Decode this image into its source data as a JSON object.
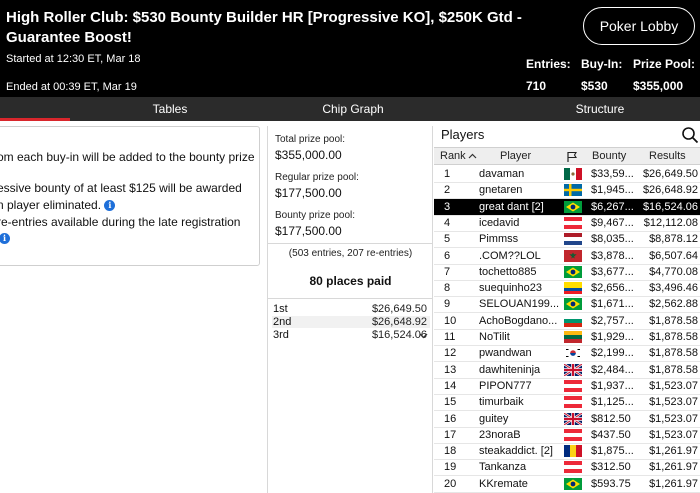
{
  "header": {
    "title": "High Roller Club: $530 Bounty Builder HR [Progressive KO], $250K Gtd - Guarantee Boost!",
    "started": "Started at 12:30 ET, Mar 18",
    "ended": "Ended at 00:39 ET, Mar 19",
    "lobby_button": "Poker Lobby",
    "stats": [
      {
        "label": "Entries:",
        "value": "710"
      },
      {
        "label": "Buy-In:",
        "value": "$530"
      },
      {
        "label": "Prize Pool:",
        "value": "$355,000"
      }
    ]
  },
  "tabs": [
    "Tables",
    "Chip Graph",
    "Structure"
  ],
  "info": {
    "line1": "om each buy-in will be added to the bounty prize",
    "line2": "essive bounty of at least $125 will be awarded",
    "line3": "n player eliminated.",
    "line4": "re-entries available during the late registration",
    "info_glyph": "i"
  },
  "prizes": {
    "total_label": "Total prize pool:",
    "total_value": "$355,000.00",
    "regular_label": "Regular prize pool:",
    "regular_value": "$177,500.00",
    "bounty_label": "Bounty prize pool:",
    "bounty_value": "$177,500.00",
    "entries_line": "(503 entries, 207 re-entries)",
    "places_paid": "80 places paid",
    "payouts": [
      {
        "place": "1st",
        "amount": "$26,649.50"
      },
      {
        "place": "2nd",
        "amount": "$26,648.92"
      },
      {
        "place": "3rd",
        "amount": "$16,524.06"
      }
    ]
  },
  "players": {
    "title": "Players",
    "columns": {
      "rank": "Rank",
      "player": "Player",
      "bounty": "Bounty",
      "results": "Results"
    },
    "rows": [
      {
        "rank": "1",
        "name": "davaman",
        "bounty": "$33,59...",
        "result": "$26,649.50",
        "flag": "mexico"
      },
      {
        "rank": "2",
        "name": "gnetaren",
        "bounty": "$1,945...",
        "result": "$26,648.92",
        "flag": "sweden"
      },
      {
        "rank": "3",
        "name": "great dant [2]",
        "bounty": "$6,267...",
        "result": "$16,524.06",
        "flag": "brazil",
        "selected": true
      },
      {
        "rank": "4",
        "name": "icedavid",
        "bounty": "$9,467...",
        "result": "$12,112.08",
        "flag": "austria"
      },
      {
        "rank": "5",
        "name": "Pimmss",
        "bounty": "$8,035...",
        "result": "$8,878.12",
        "flag": "netherlands"
      },
      {
        "rank": "6",
        "name": ".COM??LOL",
        "bounty": "$3,878...",
        "result": "$6,507.64",
        "flag": "morocco"
      },
      {
        "rank": "7",
        "name": "tochetto885",
        "bounty": "$3,677...",
        "result": "$4,770.08",
        "flag": "brazil"
      },
      {
        "rank": "8",
        "name": "suequinho23",
        "bounty": "$2,656...",
        "result": "$3,496.46",
        "flag": "ecuador"
      },
      {
        "rank": "9",
        "name": "SELOUAN199...",
        "bounty": "$1,671...",
        "result": "$2,562.88",
        "flag": "brazil"
      },
      {
        "rank": "10",
        "name": "AchoBogdano...",
        "bounty": "$2,757...",
        "result": "$1,878.58",
        "flag": "bulgaria"
      },
      {
        "rank": "11",
        "name": "NoTilit",
        "bounty": "$1,929...",
        "result": "$1,878.58",
        "flag": "lithuania"
      },
      {
        "rank": "12",
        "name": "pwandwan",
        "bounty": "$2,199...",
        "result": "$1,878.58",
        "flag": "korea"
      },
      {
        "rank": "13",
        "name": "dawhiteninja",
        "bounty": "$2,484...",
        "result": "$1,878.58",
        "flag": "uk"
      },
      {
        "rank": "14",
        "name": "PIPON777",
        "bounty": "$1,937...",
        "result": "$1,523.07",
        "flag": "austria"
      },
      {
        "rank": "15",
        "name": "timurbaik",
        "bounty": "$1,125...",
        "result": "$1,523.07",
        "flag": "austria"
      },
      {
        "rank": "16",
        "name": "guitey",
        "bounty": "$812.50",
        "result": "$1,523.07",
        "flag": "uk"
      },
      {
        "rank": "17",
        "name": "23noraB",
        "bounty": "$437.50",
        "result": "$1,523.07",
        "flag": "austria"
      },
      {
        "rank": "18",
        "name": "steakaddict. [2]",
        "bounty": "$1,875...",
        "result": "$1,261.97",
        "flag": "romania"
      },
      {
        "rank": "19",
        "name": "Tankanza",
        "bounty": "$312.50",
        "result": "$1,261.97",
        "flag": "austria"
      },
      {
        "rank": "20",
        "name": "KKremate",
        "bounty": "$593.75",
        "result": "$1,261.97",
        "flag": "brazil"
      }
    ]
  }
}
